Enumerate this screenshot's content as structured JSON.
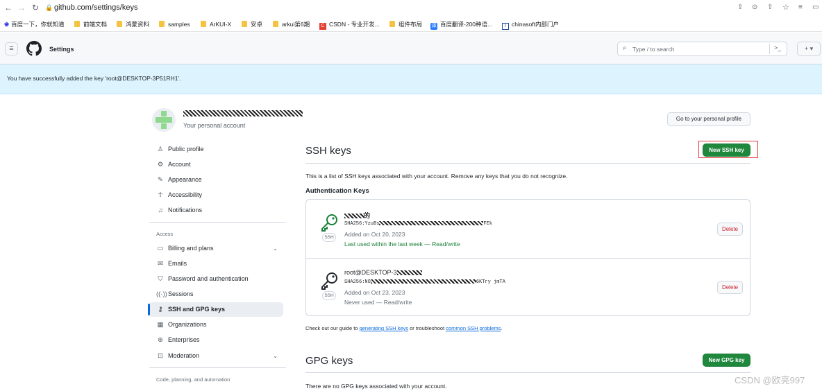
{
  "browser": {
    "url": "github.com/settings/keys",
    "bookmarks": [
      "百度一下，你就知道",
      "前端文档",
      "鸿蒙资料",
      "samples",
      "ArKUI-X",
      "安卓",
      "arkui第6期",
      "CSDN - 专业开发...",
      "组件布局",
      "百度翻译-200种语...",
      "chinasoft内部门户"
    ]
  },
  "header": {
    "title": "Settings",
    "search_placeholder": "Type / to search",
    "plus": "+ ▾"
  },
  "flash": {
    "message": "You have successfully added the key 'root@DESKTOP-3P51RH1'."
  },
  "account": {
    "subtitle": "Your personal account",
    "profile_button": "Go to your personal profile"
  },
  "sidebar": {
    "items": [
      {
        "label": "Public profile",
        "icon": "person-icon"
      },
      {
        "label": "Account",
        "icon": "gear-icon"
      },
      {
        "label": "Appearance",
        "icon": "paintbrush-icon"
      },
      {
        "label": "Accessibility",
        "icon": "accessibility-icon"
      },
      {
        "label": "Notifications",
        "icon": "bell-icon"
      }
    ],
    "access_heading": "Access",
    "access_items": [
      {
        "label": "Billing and plans",
        "icon": "credit-card-icon"
      },
      {
        "label": "Emails",
        "icon": "mail-icon"
      },
      {
        "label": "Password and authentication",
        "icon": "shield-lock-icon"
      },
      {
        "label": "Sessions",
        "icon": "broadcast-icon"
      },
      {
        "label": "SSH and GPG keys",
        "icon": "key-icon"
      },
      {
        "label": "Organizations",
        "icon": "organization-icon"
      },
      {
        "label": "Enterprises",
        "icon": "globe-icon"
      },
      {
        "label": "Moderation",
        "icon": "report-icon"
      }
    ],
    "code_heading": "Code, planning, and automation"
  },
  "ssh": {
    "title": "SSH keys",
    "new_button": "New SSH key",
    "description": "This is a list of SSH keys associated with your account. Remove any keys that you do not recognize.",
    "auth_heading": "Authentication Keys",
    "badge": "SSH",
    "delete_label": "Delete",
    "keys": [
      {
        "name_suffix": "的",
        "fp_prefix": "SHA256:YzuBs",
        "fp_suffix": "FEk",
        "added": "Added on Oct 20, 2023",
        "usage": "Last used within the last week — Read/write"
      },
      {
        "name": "root@DESKTOP-3",
        "fp_prefix": "SHA256:NO",
        "fp_suffix": "6KTry jmTA",
        "added": "Added on Oct 23, 2023",
        "usage": "Never used — Read/write"
      }
    ],
    "guide_prefix": "Check out our guide to ",
    "guide_link1": "generating SSH keys",
    "guide_mid": " or troubleshoot ",
    "guide_link2": "common SSH problems",
    "guide_end": "."
  },
  "gpg": {
    "title": "GPG keys",
    "new_button": "New GPG key",
    "description": "There are no GPG keys associated with your account."
  },
  "watermark": "CSDN @欧亮997",
  "colors": {
    "accent": "#0969da",
    "green": "#1f883d",
    "danger": "#cf222e",
    "flash_bg": "#ddf4ff"
  }
}
